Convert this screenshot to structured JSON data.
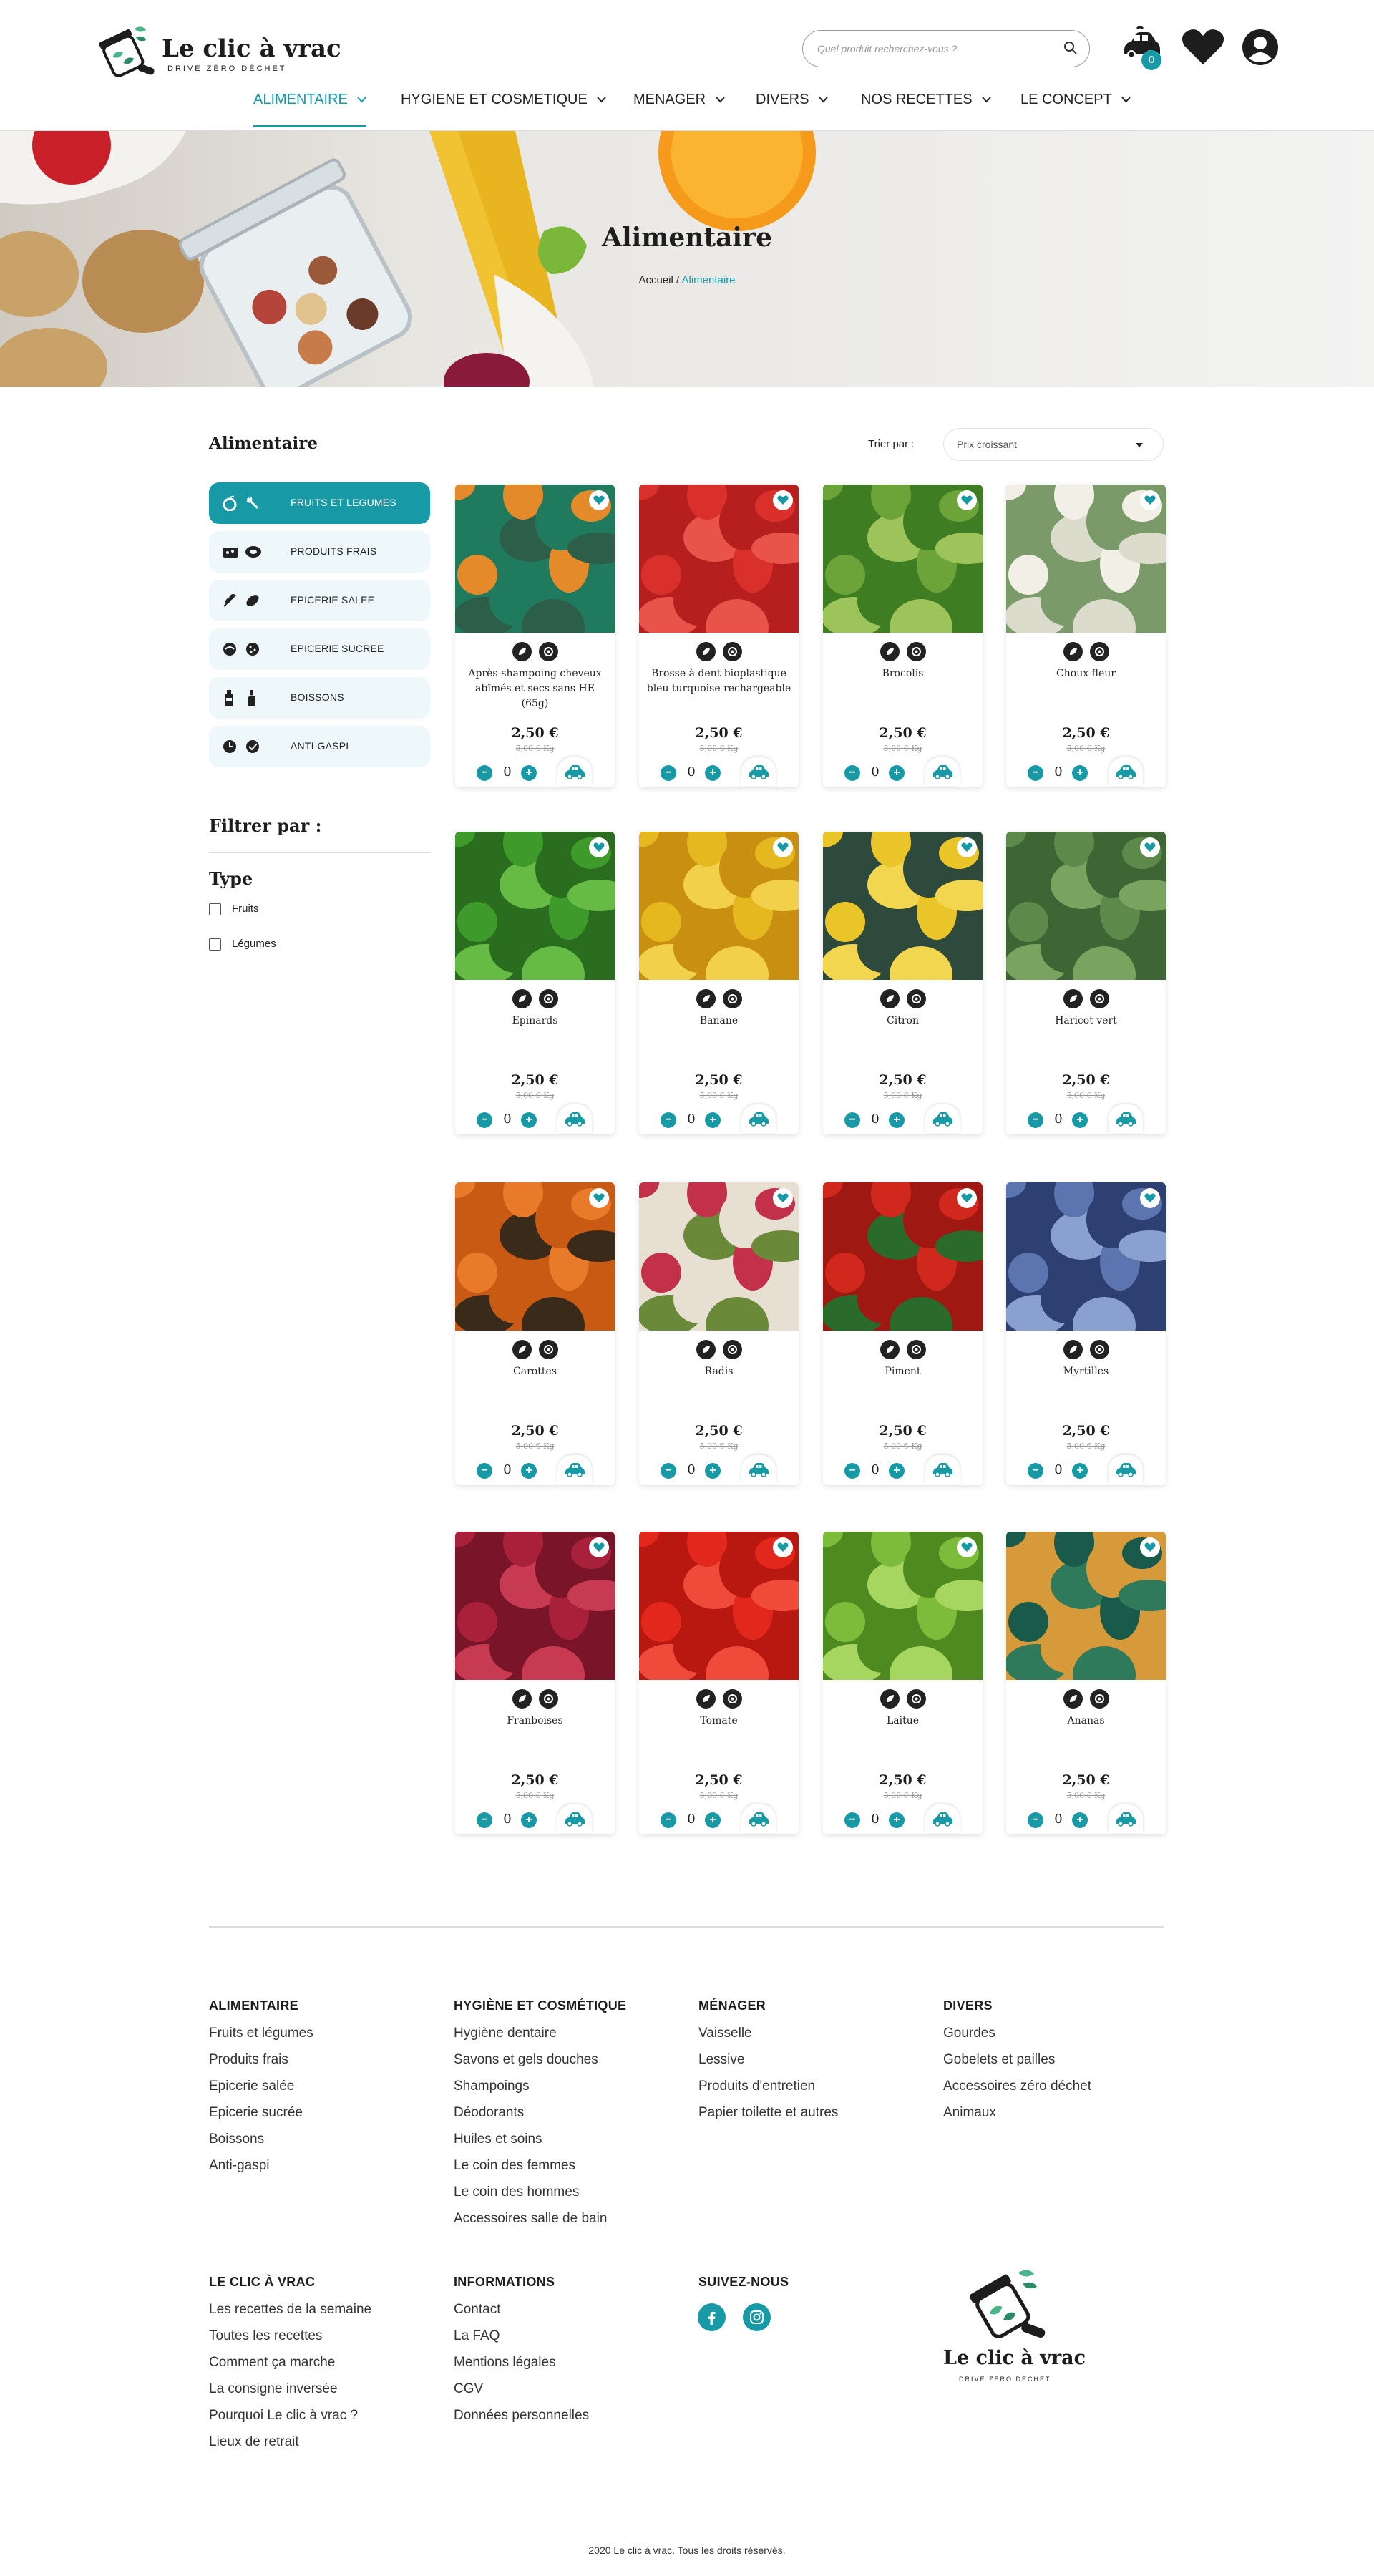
{
  "header": {
    "logo_title": "Le clic à vrac",
    "logo_subtitle": "DRIVE ZÉRO DÉCHET",
    "search_placeholder": "Quel produit recherchez-vous ?",
    "cart_count": "0"
  },
  "nav": [
    {
      "label": "ALIMENTAIRE",
      "active": true
    },
    {
      "label": "HYGIENE ET COSMETIQUE",
      "active": false
    },
    {
      "label": "MENAGER",
      "active": false
    },
    {
      "label": "DIVERS",
      "active": false
    },
    {
      "label": "NOS RECETTES",
      "active": false
    },
    {
      "label": "LE CONCEPT",
      "active": false
    }
  ],
  "hero": {
    "title": "Alimentaire",
    "breadcrumb_home": "Accueil",
    "breadcrumb_sep": " / ",
    "breadcrumb_current": "Alimentaire"
  },
  "sidebar": {
    "title": "Alimentaire",
    "categories": [
      {
        "label": "FRUITS ET LEGUMES",
        "active": true
      },
      {
        "label": "PRODUITS FRAIS",
        "active": false
      },
      {
        "label": "EPICERIE SALEE",
        "active": false
      },
      {
        "label": "EPICERIE SUCREE",
        "active": false
      },
      {
        "label": "BOISSONS",
        "active": false
      },
      {
        "label": "ANTI-GASPI",
        "active": false
      }
    ],
    "filter_title": "Filtrer par :",
    "type_title": "Type",
    "type_options": [
      "Fruits",
      "Légumes"
    ]
  },
  "sort": {
    "label": "Trier par :",
    "value": "Prix croissant"
  },
  "products": [
    {
      "name": "Après-shampoing cheveux abîmés et secs sans HE (65g)",
      "price": "2,50 €",
      "unit": "5,00 € Kg",
      "qty": "0",
      "colors": [
        "#e58a2a",
        "#1f7a5e",
        "#2d5e4a"
      ]
    },
    {
      "name": "Brosse à dent bioplastique bleu turquoise rechargeable",
      "price": "2,50 €",
      "unit": "5,00 € Kg",
      "qty": "0",
      "colors": [
        "#d9302b",
        "#b71f1f",
        "#e9534a"
      ]
    },
    {
      "name": "Brocolis",
      "price": "2,50 €",
      "unit": "5,00 € Kg",
      "qty": "0",
      "colors": [
        "#6da43a",
        "#3f7d23",
        "#9cc45a"
      ]
    },
    {
      "name": "Choux-fleur",
      "price": "2,50 €",
      "unit": "5,00 € Kg",
      "qty": "0",
      "colors": [
        "#f1efe6",
        "#7a9a6a",
        "#dcdccc"
      ]
    },
    {
      "name": "Epinards",
      "price": "2,50 €",
      "unit": "5,00 € Kg",
      "qty": "0",
      "colors": [
        "#3f9a2c",
        "#2a6d1f",
        "#66bb44"
      ]
    },
    {
      "name": "Banane",
      "price": "2,50 €",
      "unit": "5,00 € Kg",
      "qty": "0",
      "colors": [
        "#e6b820",
        "#c98f10",
        "#f3d04a"
      ]
    },
    {
      "name": "Citron",
      "price": "2,50 €",
      "unit": "5,00 € Kg",
      "qty": "0",
      "colors": [
        "#e9c52a",
        "#2d4a3d",
        "#f2d650"
      ]
    },
    {
      "name": "Haricot vert",
      "price": "2,50 €",
      "unit": "5,00 € Kg",
      "qty": "0",
      "colors": [
        "#5d8a4a",
        "#3d6634",
        "#7aa360"
      ]
    },
    {
      "name": "Carottes",
      "price": "2,50 €",
      "unit": "5,00 € Kg",
      "qty": "0",
      "colors": [
        "#e87a2a",
        "#c85a14",
        "#3a2a1a"
      ]
    },
    {
      "name": "Radis",
      "price": "2,50 €",
      "unit": "5,00 € Kg",
      "qty": "0",
      "colors": [
        "#c2304a",
        "#e7e0d2",
        "#6a8a3a"
      ]
    },
    {
      "name": "Piment",
      "price": "2,50 €",
      "unit": "5,00 € Kg",
      "qty": "0",
      "colors": [
        "#d1281e",
        "#a01812",
        "#2a6a2a"
      ]
    },
    {
      "name": "Myrtilles",
      "price": "2,50 €",
      "unit": "5,00 € Kg",
      "qty": "0",
      "colors": [
        "#5c74b0",
        "#2e3f72",
        "#8aa0d0"
      ]
    },
    {
      "name": "Franboises",
      "price": "2,50 €",
      "unit": "5,00 € Kg",
      "qty": "0",
      "colors": [
        "#a8203a",
        "#7a1428",
        "#c83a52"
      ]
    },
    {
      "name": "Tomate",
      "price": "2,50 €",
      "unit": "5,00 € Kg",
      "qty": "0",
      "colors": [
        "#e2281c",
        "#b81810",
        "#f04a3a"
      ]
    },
    {
      "name": "Laitue",
      "price": "2,50 €",
      "unit": "5,00 € Kg",
      "qty": "0",
      "colors": [
        "#7cbc3a",
        "#4e8a20",
        "#a6d660"
      ]
    },
    {
      "name": "Ananas",
      "price": "2,50 €",
      "unit": "5,00 € Kg",
      "qty": "0",
      "colors": [
        "#1a5a4a",
        "#d69a3a",
        "#2e7a5a"
      ]
    }
  ],
  "footer": {
    "columns": [
      {
        "title": "ALIMENTAIRE",
        "links": [
          "Fruits et légumes",
          "Produits frais",
          "Epicerie salée",
          "Epicerie sucrée",
          "Boissons",
          "Anti-gaspi"
        ]
      },
      {
        "title": "HYGIÈNE ET COSMÉTIQUE",
        "links": [
          "Hygiène dentaire",
          "Savons et gels douches",
          "Shampoings",
          "Déodorants",
          "Huiles et soins",
          "Le coin des femmes",
          "Le coin des hommes",
          "Accessoires salle de bain"
        ]
      },
      {
        "title": "MÉNAGER",
        "links": [
          "Vaisselle",
          "Lessive",
          "Produits d'entretien",
          "Papier toilette et autres"
        ]
      },
      {
        "title": "DIVERS",
        "links": [
          "Gourdes",
          "Gobelets et pailles",
          "Accessoires zéro déchet",
          "Animaux"
        ]
      },
      {
        "title": "LE CLIC À VRAC",
        "links": [
          "Les recettes de la semaine",
          "Toutes les recettes",
          "Comment ça marche",
          "La consigne inversée",
          "Pourquoi Le clic à vrac ?",
          "Lieux de retrait"
        ]
      },
      {
        "title": "INFORMATIONS",
        "links": [
          "Contact",
          "La FAQ",
          "Mentions légales",
          "CGV",
          "Données personnelles"
        ]
      },
      {
        "title": "SUIVEZ-NOUS",
        "links": []
      }
    ],
    "logo_title": "Le clic à vrac",
    "logo_subtitle": "DRIVE ZÉRO DÉCHET",
    "copyright": "2020 Le clic à vrac. Tous  les droits réservés."
  },
  "colors": {
    "accent": "#1799a6",
    "accent_light": "#eef8fa",
    "dark": "#1d1d1d"
  }
}
